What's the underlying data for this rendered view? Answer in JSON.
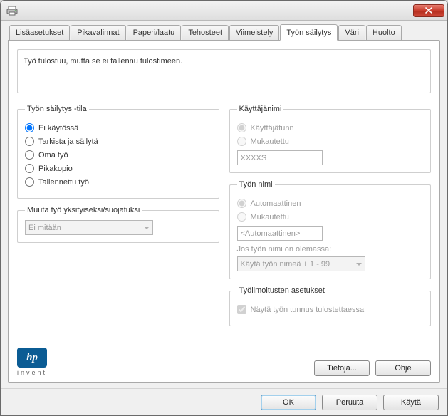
{
  "window": {
    "title": ""
  },
  "tabs": {
    "advanced": "Lisäasetukset",
    "shortcuts": "Pikavalinnat",
    "paper": "Paperi/laatu",
    "effects": "Tehosteet",
    "finishing": "Viimeistely",
    "storage": "Työn säilytys",
    "color": "Väri",
    "service": "Huolto"
  },
  "description": "Työ tulostuu, mutta se ei tallennu tulostimeen.",
  "storage_mode": {
    "legend": "Työn säilytys -tila",
    "off": "Ei käytössä",
    "proof": "Tarkista ja säilytä",
    "personal": "Oma työ",
    "quick": "Pikakopio",
    "stored": "Tallennettu työ",
    "selected": "off"
  },
  "privacy": {
    "legend": "Muuta työ yksityiseksi/suojatuksi",
    "value": "Ei mitään"
  },
  "username": {
    "legend": "Käyttäjänimi",
    "username_label": "Käyttäjätunn",
    "custom_label": "Mukautettu",
    "value": "XXXXS"
  },
  "jobname": {
    "legend": "Työn nimi",
    "auto_label": "Automaattinen",
    "custom_label": "Mukautettu",
    "value": "<Automaattinen>",
    "exists_label": "Jos työn nimi on olemassa:",
    "exists_value": "Käytä työn nimeä + 1 - 99"
  },
  "notify": {
    "legend": "Työilmoitusten asetukset",
    "show_id": "Näytä työn tunnus tulostettaessa"
  },
  "logo": {
    "brand": "hp",
    "tag": "invent"
  },
  "buttons": {
    "about": "Tietoja...",
    "help": "Ohje",
    "ok": "OK",
    "cancel": "Peruuta",
    "apply": "Käytä"
  }
}
